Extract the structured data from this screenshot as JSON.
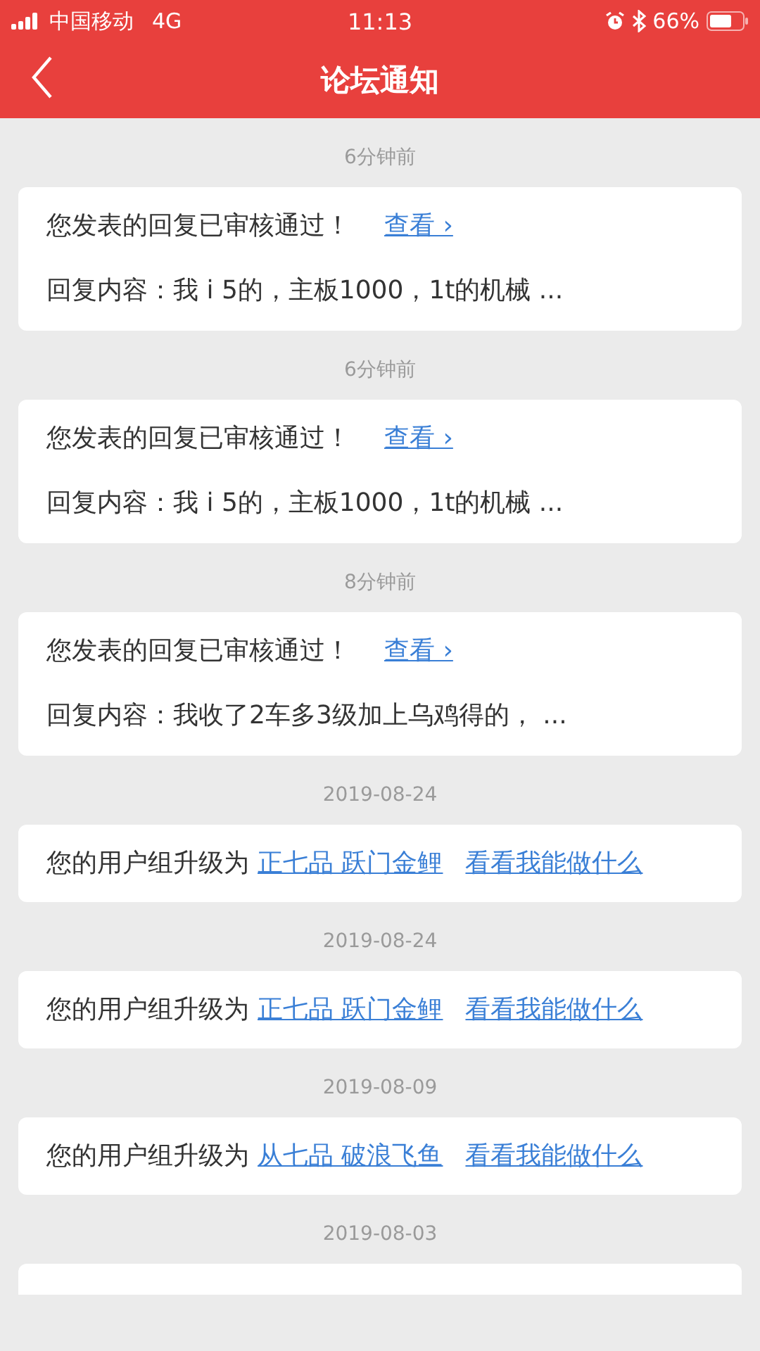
{
  "status_bar": {
    "carrier": "中国移动",
    "network": "4G",
    "time": "11:13",
    "battery": "66%"
  },
  "header": {
    "title": "论坛通知"
  },
  "notifications": [
    {
      "time": "6分钟前",
      "kind": "review",
      "title": "您发表的回复已审核通过！",
      "link": "查看 ›",
      "content": "回复内容：我 i 5的，主板1000，1t的机械 ..."
    },
    {
      "time": "6分钟前",
      "kind": "review",
      "title": "您发表的回复已审核通过！",
      "link": "查看 ›",
      "content": "回复内容：我 i 5的，主板1000，1t的机械 ..."
    },
    {
      "time": "8分钟前",
      "kind": "review",
      "title": "您发表的回复已审核通过！",
      "link": "查看 ›",
      "content": "回复内容：我收了2车多3级加上乌鸡得的，  ..."
    },
    {
      "time": "2019-08-24",
      "kind": "upgrade",
      "text": "您的用户组升级为",
      "rank": "正七品 跃门金鲤",
      "action": "看看我能做什么"
    },
    {
      "time": "2019-08-24",
      "kind": "upgrade",
      "text": "您的用户组升级为",
      "rank": "正七品 跃门金鲤",
      "action": "看看我能做什么"
    },
    {
      "time": "2019-08-09",
      "kind": "upgrade",
      "text": "您的用户组升级为",
      "rank": "从七品 破浪飞鱼",
      "action": "看看我能做什么"
    },
    {
      "time": "2019-08-03",
      "kind": "partial"
    }
  ]
}
